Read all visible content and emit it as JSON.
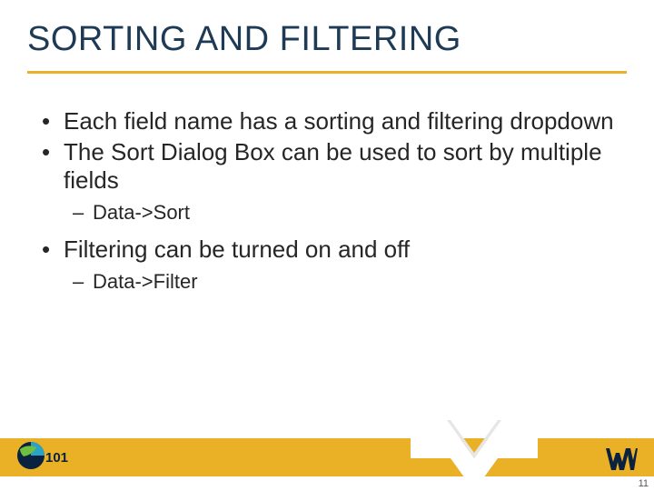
{
  "title": "SORTING AND FILTERING",
  "bullets": [
    {
      "level": 1,
      "text": "Each field name has a sorting and filtering dropdown"
    },
    {
      "level": 1,
      "text": "The Sort Dialog Box can be used to sort by multiple fields"
    },
    {
      "level": 2,
      "text": "Data->Sort"
    },
    {
      "level": 1,
      "text": "Filtering can be turned on and off"
    },
    {
      "level": 2,
      "text": "Data->Filter"
    }
  ],
  "page_number": "11",
  "colors": {
    "accent_yellow": "#eab126",
    "title_navy": "#1f3a54",
    "wv_navy": "#0b2140"
  }
}
